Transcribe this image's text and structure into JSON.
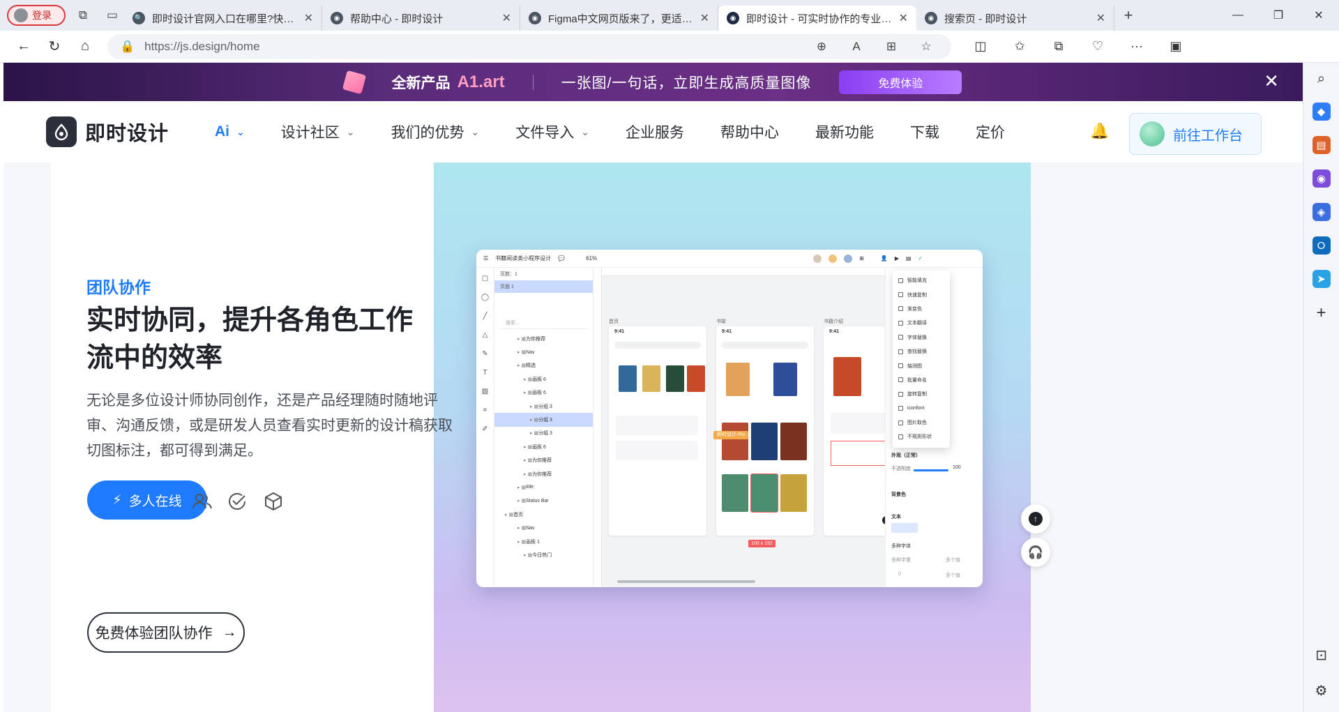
{
  "browser": {
    "profile_label": "登录",
    "tabs": [
      {
        "title": "即时设计官网入口在哪里?快来看看"
      },
      {
        "title": "帮助中心 - 即时设计"
      },
      {
        "title": "Figma中文网页版来了，更适合国人"
      },
      {
        "title": "即时设计 - 可实时协作的专业 UI"
      },
      {
        "title": "搜索页 - 即时设计"
      }
    ],
    "active_tab_index": 3,
    "url": "https://js.design/home"
  },
  "promo": {
    "product_label": "全新产品",
    "product_name": "A1.art",
    "slogan": "一张图/一句话，立即生成高质量图像",
    "button": "免费体验"
  },
  "nav": {
    "brand": "即时设计",
    "items": [
      {
        "label": "Ai"
      },
      {
        "label": "设计社区"
      },
      {
        "label": "我们的优势"
      },
      {
        "label": "文件导入"
      },
      {
        "label": "企业服务"
      },
      {
        "label": "帮助中心"
      },
      {
        "label": "最新功能"
      },
      {
        "label": "下载"
      },
      {
        "label": "定价"
      }
    ],
    "workspace_button": "前往工作台"
  },
  "hero": {
    "kicker": "团队协作",
    "headline": "实时协同，提升各角色工作流中的效率",
    "description": "无论是多位设计师协同创作，还是产品经理随时随地评审、沟通反馈，或是研发人员查看实时更新的设计稿获取切图标注，都可得到满足。",
    "online_button": "多人在线",
    "cta": "免费体验团队协作"
  },
  "editor": {
    "file_name": "书籍阅读类小程序设计",
    "zoom": "61%",
    "pages_header": "页数：1",
    "page": "页面 1",
    "search_placeholder": "搜索...",
    "layers": [
      {
        "label": "为你推荐",
        "indent": 3
      },
      {
        "label": "Nav",
        "indent": 3
      },
      {
        "label": "精选",
        "indent": 3
      },
      {
        "label": "画板 6",
        "indent": 4
      },
      {
        "label": "画板 6",
        "indent": 4
      },
      {
        "label": "分组 3",
        "indent": 5
      },
      {
        "label": "分组 3",
        "indent": 5,
        "selected": true
      },
      {
        "label": "分组 3",
        "indent": 5
      },
      {
        "label": "画板 6",
        "indent": 4
      },
      {
        "label": "为你推荐",
        "indent": 4
      },
      {
        "label": "为你推荐",
        "indent": 4
      },
      {
        "label": "title",
        "indent": 3
      },
      {
        "label": "Status Bar",
        "indent": 3
      },
      {
        "label": "首页",
        "indent": 1
      },
      {
        "label": "Nav",
        "indent": 3
      },
      {
        "label": "画板 1",
        "indent": 3
      },
      {
        "label": "今日热门",
        "indent": 4
      }
    ],
    "frames": [
      {
        "label": "首页",
        "time": "9:41"
      },
      {
        "label": "书架",
        "time": "9:41"
      },
      {
        "label": "书籍介绍",
        "time": "9:41"
      }
    ],
    "collab_badge": "即时设计-Pio",
    "dimension": "100 x 192",
    "menu": [
      "智能填充",
      "快速复制",
      "渐变色",
      "文本翻译",
      "字体替换",
      "查找替换",
      "轴测图",
      "批量命名",
      "旋转复制",
      "iconfont",
      "图片取色",
      "不规则形状"
    ],
    "props": {
      "appearance": "外观（正常）",
      "opacity_label": "不透明度",
      "opacity_value": "100",
      "fill": "背景色",
      "text": "文本",
      "font": "多种字体",
      "weight": "多种字重",
      "size": "多个值",
      "lh": "0",
      "ls": "多个值"
    }
  }
}
